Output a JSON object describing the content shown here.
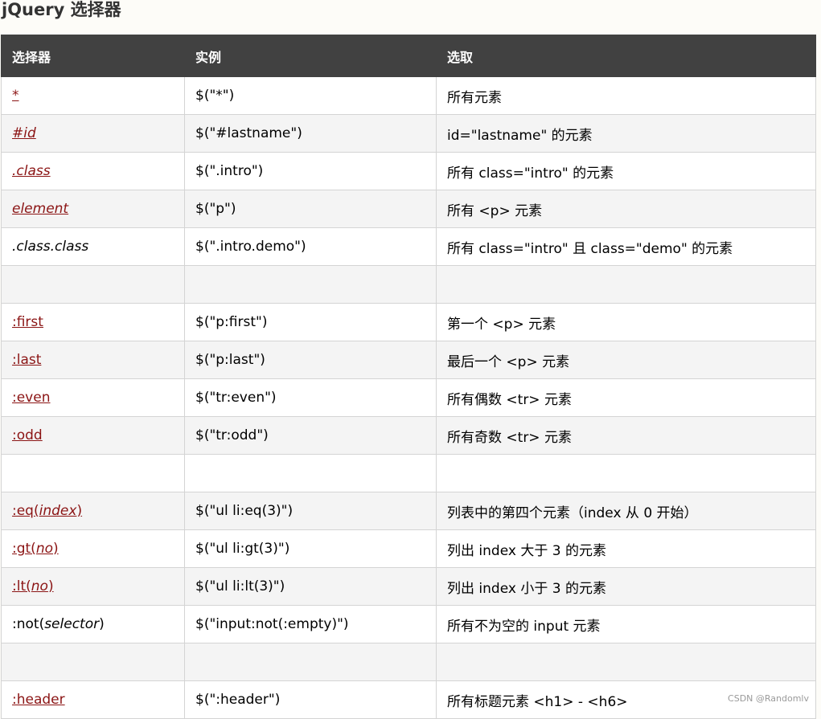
{
  "title": "jQuery 选择器",
  "table": {
    "headers": [
      "选择器",
      "实例",
      "选取"
    ],
    "rows": [
      {
        "selector": [
          {
            "t": "*",
            "i": false
          }
        ],
        "link": true,
        "example": "$(\"*\")",
        "desc": "所有元素"
      },
      {
        "selector": [
          {
            "t": "#id",
            "i": true
          }
        ],
        "link": true,
        "example": "$(\"#lastname\")",
        "desc": "id=\"lastname\" 的元素"
      },
      {
        "selector": [
          {
            "t": ".class",
            "i": true
          }
        ],
        "link": true,
        "example": "$(\".intro\")",
        "desc": "所有 class=\"intro\" 的元素"
      },
      {
        "selector": [
          {
            "t": "element",
            "i": true
          }
        ],
        "link": true,
        "example": "$(\"p\")",
        "desc": "所有 <p> 元素"
      },
      {
        "selector": [
          {
            "t": ".class.class",
            "i": true
          }
        ],
        "link": false,
        "example": "$(\".intro.demo\")",
        "desc": "所有 class=\"intro\" 且 class=\"demo\" 的元素"
      },
      {
        "selector": [],
        "link": false,
        "example": "",
        "desc": ""
      },
      {
        "selector": [
          {
            "t": ":first",
            "i": false
          }
        ],
        "link": true,
        "example": "$(\"p:first\")",
        "desc": "第一个 <p> 元素"
      },
      {
        "selector": [
          {
            "t": ":last",
            "i": false
          }
        ],
        "link": true,
        "example": "$(\"p:last\")",
        "desc": "最后一个 <p> 元素"
      },
      {
        "selector": [
          {
            "t": ":even",
            "i": false
          }
        ],
        "link": true,
        "example": "$(\"tr:even\")",
        "desc": "所有偶数 <tr> 元素"
      },
      {
        "selector": [
          {
            "t": ":odd",
            "i": false
          }
        ],
        "link": true,
        "example": "$(\"tr:odd\")",
        "desc": "所有奇数 <tr> 元素"
      },
      {
        "selector": [],
        "link": false,
        "example": "",
        "desc": ""
      },
      {
        "selector": [
          {
            "t": ":eq(",
            "i": false
          },
          {
            "t": "index",
            "i": true
          },
          {
            "t": ")",
            "i": false
          }
        ],
        "link": true,
        "example": "$(\"ul li:eq(3)\")",
        "desc": "列表中的第四个元素（index 从 0 开始）"
      },
      {
        "selector": [
          {
            "t": ":gt(",
            "i": false
          },
          {
            "t": "no",
            "i": true
          },
          {
            "t": ")",
            "i": false
          }
        ],
        "link": true,
        "example": "$(\"ul li:gt(3)\")",
        "desc": "列出 index 大于 3 的元素"
      },
      {
        "selector": [
          {
            "t": ":lt(",
            "i": false
          },
          {
            "t": "no",
            "i": true
          },
          {
            "t": ")",
            "i": false
          }
        ],
        "link": true,
        "example": "$(\"ul li:lt(3)\")",
        "desc": "列出 index 小于 3 的元素"
      },
      {
        "selector": [
          {
            "t": ":not(",
            "i": false
          },
          {
            "t": "selector",
            "i": true
          },
          {
            "t": ")",
            "i": false
          }
        ],
        "link": false,
        "example": "$(\"input:not(:empty)\")",
        "desc": "所有不为空的 input 元素"
      },
      {
        "selector": [],
        "link": false,
        "example": "",
        "desc": ""
      },
      {
        "selector": [
          {
            "t": ":header",
            "i": false
          }
        ],
        "link": true,
        "example": "$(\":header\")",
        "desc": "所有标题元素 <h1> - <h6>"
      }
    ]
  },
  "watermark": "CSDN @Randomlv",
  "colors": {
    "header_bg": "#414141",
    "link": "#8b1414",
    "row_alt": "#f4f4f4",
    "border": "#d4d4d4"
  }
}
